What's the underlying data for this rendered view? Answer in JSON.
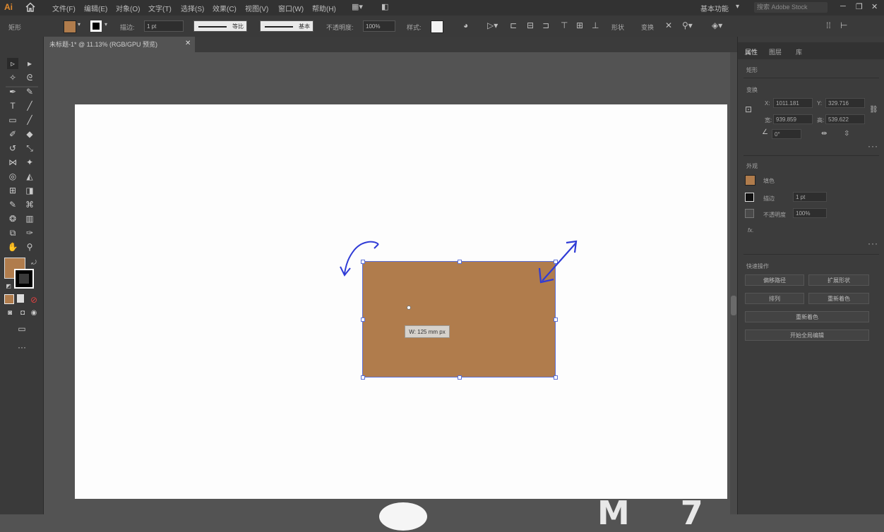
{
  "app": {
    "logo": "Ai"
  },
  "menubar": {
    "items": [
      "文件(F)",
      "编辑(E)",
      "对象(O)",
      "文字(T)",
      "选择(S)",
      "效果(C)",
      "视图(V)",
      "窗口(W)",
      "帮助(H)"
    ],
    "workspace": "基本功能",
    "search_placeholder": "搜索 Adobe Stock",
    "win_minimize": "─",
    "win_restore": "❐",
    "win_close": "✕"
  },
  "controlbar": {
    "panel_label": "矩形",
    "stroke_label": "描边:",
    "stroke_weight": "1 pt",
    "stroke_profile_label": "等比",
    "brush_label": "基本",
    "opacity_label": "不透明度:",
    "opacity_value": "100%",
    "style_label": "样式:",
    "shape_label": "形状",
    "transform_label": "变换"
  },
  "colors": {
    "fill": "#b07c4c",
    "accent": "#5b6fd6",
    "annotation": "#2f3bd6"
  },
  "document": {
    "tab_title": "未标题-1* @ 11.13% (RGB/GPU 预览)",
    "close": "✕"
  },
  "canvas": {
    "dimension_tooltip": "W: 125 mm px"
  },
  "panel": {
    "tabs": [
      "属性",
      "图层",
      "库"
    ],
    "section_shape": "矩形",
    "section_transform": "变换",
    "x_label": "X:",
    "x_value": "1011.181",
    "y_label": "Y:",
    "y_value": "329.716",
    "w_label": "宽:",
    "w_value": "939.859",
    "h_label": "高:",
    "h_value": "539.622",
    "angle_value": "0°",
    "section_appearance": "外观",
    "fill_label": "填色",
    "stroke_label": "描边",
    "stroke_value": "1 pt",
    "opacity_label": "不透明度",
    "opacity_value": "100%",
    "fx_label": "fx.",
    "section_quick_actions": "快速操作",
    "btn_offset_path": "偏移路径",
    "btn_expand_shape": "扩展形状",
    "btn_arrange": "排列",
    "btn_recolor": "重新着色",
    "btn_start_global_edit": "开始全局编辑",
    "btn_rename": "重新着色"
  },
  "watermark": {
    "text": "M 7"
  }
}
